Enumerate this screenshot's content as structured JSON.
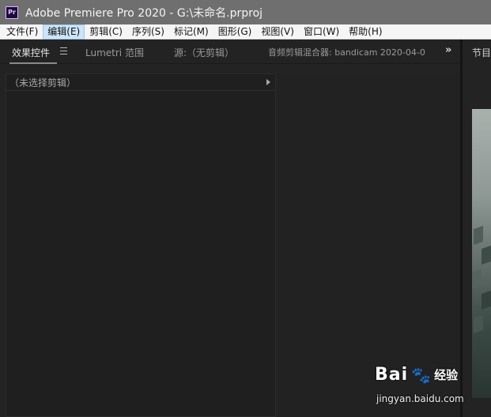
{
  "window": {
    "app_icon_text": "Pr",
    "title": "Adobe Premiere Pro 2020 - G:\\未命名.prproj"
  },
  "menubar": {
    "items": [
      {
        "label": "文件(F)"
      },
      {
        "label": "编辑(E)"
      },
      {
        "label": "剪辑(C)"
      },
      {
        "label": "序列(S)"
      },
      {
        "label": "标记(M)"
      },
      {
        "label": "图形(G)"
      },
      {
        "label": "视图(V)"
      },
      {
        "label": "窗口(W)"
      },
      {
        "label": "帮助(H)"
      }
    ],
    "active_index": 1
  },
  "panels": {
    "tabs": [
      {
        "label": "效果控件"
      },
      {
        "label": "Lumetri 范围"
      },
      {
        "label": "源:（无剪辑）"
      },
      {
        "label": "音频剪辑混合器: bandicam 2020-04-0"
      }
    ],
    "overflow_icon": "double-chevron-right-icon",
    "effects": {
      "header_label": "（未选择剪辑）"
    },
    "right_tab_label": "节目"
  },
  "watermark": {
    "brand": "Bai",
    "brand_suffix": "经验",
    "url": "jingyan.baidu.com"
  },
  "colors": {
    "titlebar": "#6f6f6f",
    "menubar": "#f5f5f5",
    "panel_bg": "#232323",
    "active_menu": "#cce4f7"
  }
}
